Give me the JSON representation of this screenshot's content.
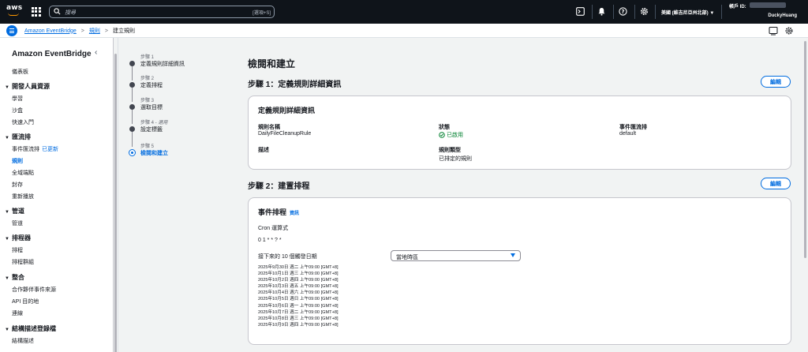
{
  "topbar": {
    "logo_text": "aws",
    "search_placeholder": "搜尋",
    "search_hint": "[選項+S]",
    "region": "美國 (維吉尼亞州北部) ▼",
    "account_label": "帳戶 ID:",
    "user": "DuckyHuang",
    "icons": [
      "grid-icon",
      "search-icon",
      "terminal-icon",
      "bell-icon",
      "help-icon",
      "gear-icon"
    ]
  },
  "breadcrumb": {
    "service": "Amazon EventBridge",
    "parent": "規則",
    "current": "建立規則",
    "separator": ">"
  },
  "sidebar": {
    "title": "Amazon EventBridge",
    "close": "‹",
    "dashboard": "儀表板",
    "groups": [
      {
        "head": "開發人員資源",
        "items": [
          "學習",
          "沙盒",
          "快速入門"
        ]
      },
      {
        "head": "匯流排",
        "items": [
          "事件匯流排",
          "規則",
          "全域端點",
          "封存",
          "重新播放"
        ],
        "new_badge": "已更新"
      },
      {
        "head": "管道",
        "items": [
          "管道"
        ]
      },
      {
        "head": "排程器",
        "items": [
          "排程",
          "排程群組"
        ]
      },
      {
        "head": "整合",
        "items": [
          "合作夥伴事件來源",
          "API 目的地",
          "連線"
        ]
      },
      {
        "head": "結構描述登錄檔",
        "items": [
          "結構描述"
        ]
      }
    ]
  },
  "steps": [
    {
      "label": "步驟 1",
      "title": "定義規則詳細資訊"
    },
    {
      "label": "步驟 2",
      "title": "定義排程"
    },
    {
      "label": "步驟 3",
      "title": "選取目標"
    },
    {
      "label": "步驟 4 -",
      "optional": "選用",
      "title": "設定標籤"
    },
    {
      "label": "步驟 5",
      "title": "檢閱和建立"
    }
  ],
  "main": {
    "title": "檢閱和建立",
    "edit_label": "編輯",
    "step1": {
      "heading": "步驟 1：定義規則詳細資訊",
      "card_title": "定義規則詳細資訊",
      "rule_name_k": "規則名稱",
      "rule_name_v": "DailyFileCleanupRule",
      "status_k": "狀態",
      "status_v": "已啟用",
      "bus_k": "事件匯流排",
      "bus_v": "default",
      "desc_k": "描述",
      "type_k": "規則類型",
      "type_v": "已排定的規則"
    },
    "step2": {
      "heading": "步驟 2：建置排程",
      "card_title": "事件排程",
      "info": "資訊",
      "cron_label": "Cron 運算式",
      "cron_value": "0 1 * * ? *",
      "next_label": "接下來的 10 個觸發日期",
      "tz_value": "當地時區",
      "dates": [
        "2025年9月30日 週二 上午09:00 [GMT+8]",
        "2025年10月1日 週三 上午09:00 [GMT+8]",
        "2025年10月2日 週四 上午09:00 [GMT+8]",
        "2025年10月3日 週五 上午09:00 [GMT+8]",
        "2025年10月4日 週六 上午09:00 [GMT+8]",
        "2025年10月5日 週日 上午09:00 [GMT+8]",
        "2025年10月6日 週一 上午09:00 [GMT+8]",
        "2025年10月7日 週二 上午09:00 [GMT+8]",
        "2025年10月8日 週三 上午09:00 [GMT+8]",
        "2025年10月9日 週四 上午09:00 [GMT+8]"
      ]
    }
  },
  "colors": {
    "accent": "#006ce0",
    "topbar": "#0f141a",
    "success": "#00802f"
  }
}
